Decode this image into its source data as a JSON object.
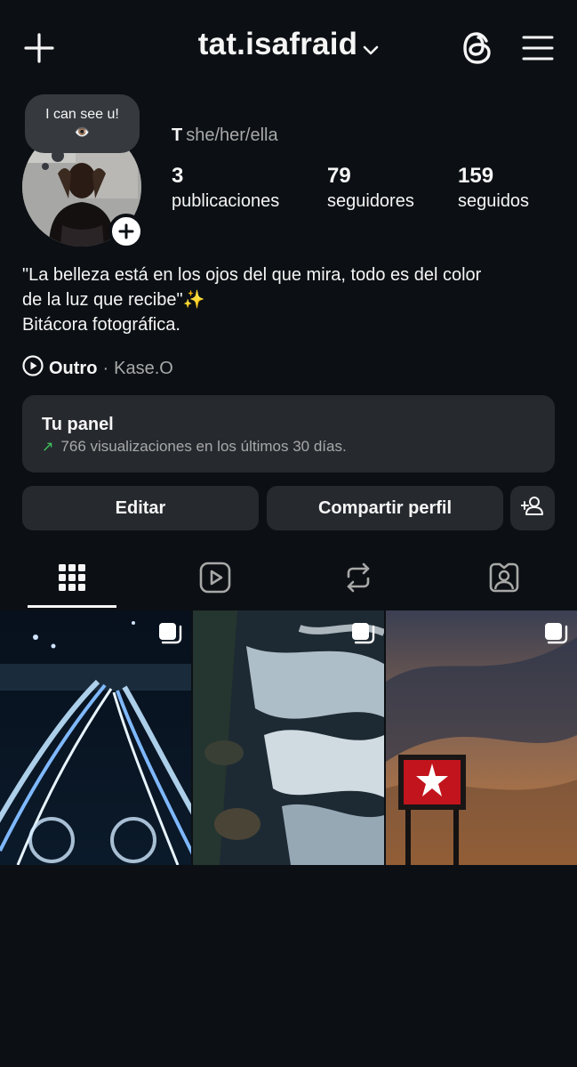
{
  "header": {
    "username": "tat.isafraid"
  },
  "note": {
    "text": "I can see u!",
    "emoji": "👁️"
  },
  "profile": {
    "initial": "T",
    "pronouns": "she/her/ella",
    "stats": [
      {
        "value": "3",
        "label": "publicaciones"
      },
      {
        "value": "79",
        "label": "seguidores"
      },
      {
        "value": "159",
        "label": "seguidos"
      }
    ],
    "bio": [
      "\"La belleza está en los ojos del que mira, todo es del color",
      "de la luz que recibe\"✨",
      "Bitácora fotográfica."
    ],
    "music": {
      "title": "Outro",
      "separator": "·",
      "artist": "Kase.O"
    }
  },
  "panel": {
    "title": "Tu panel",
    "arrow": "↗",
    "subtitle": "766 visualizaciones en los últimos 30 días."
  },
  "buttons": {
    "edit": "Editar",
    "share": "Compartir perfil"
  },
  "tabs": [
    {
      "icon": "grid-icon",
      "selected": true
    },
    {
      "icon": "reels-icon",
      "selected": false
    },
    {
      "icon": "reposts-icon",
      "selected": false
    },
    {
      "icon": "tagged-icon",
      "selected": false
    }
  ],
  "colors": {
    "background": "#0c1014",
    "surface": "#262a2f",
    "secondary_text": "#a8a8a8",
    "accent_green": "#3ec45a"
  },
  "posts": [
    {
      "subject": "light-trails-night-road",
      "multiple": true
    },
    {
      "subject": "rushing-water-rocks",
      "multiple": true
    },
    {
      "subject": "texaco-sign-sunset-sky",
      "multiple": true
    }
  ]
}
